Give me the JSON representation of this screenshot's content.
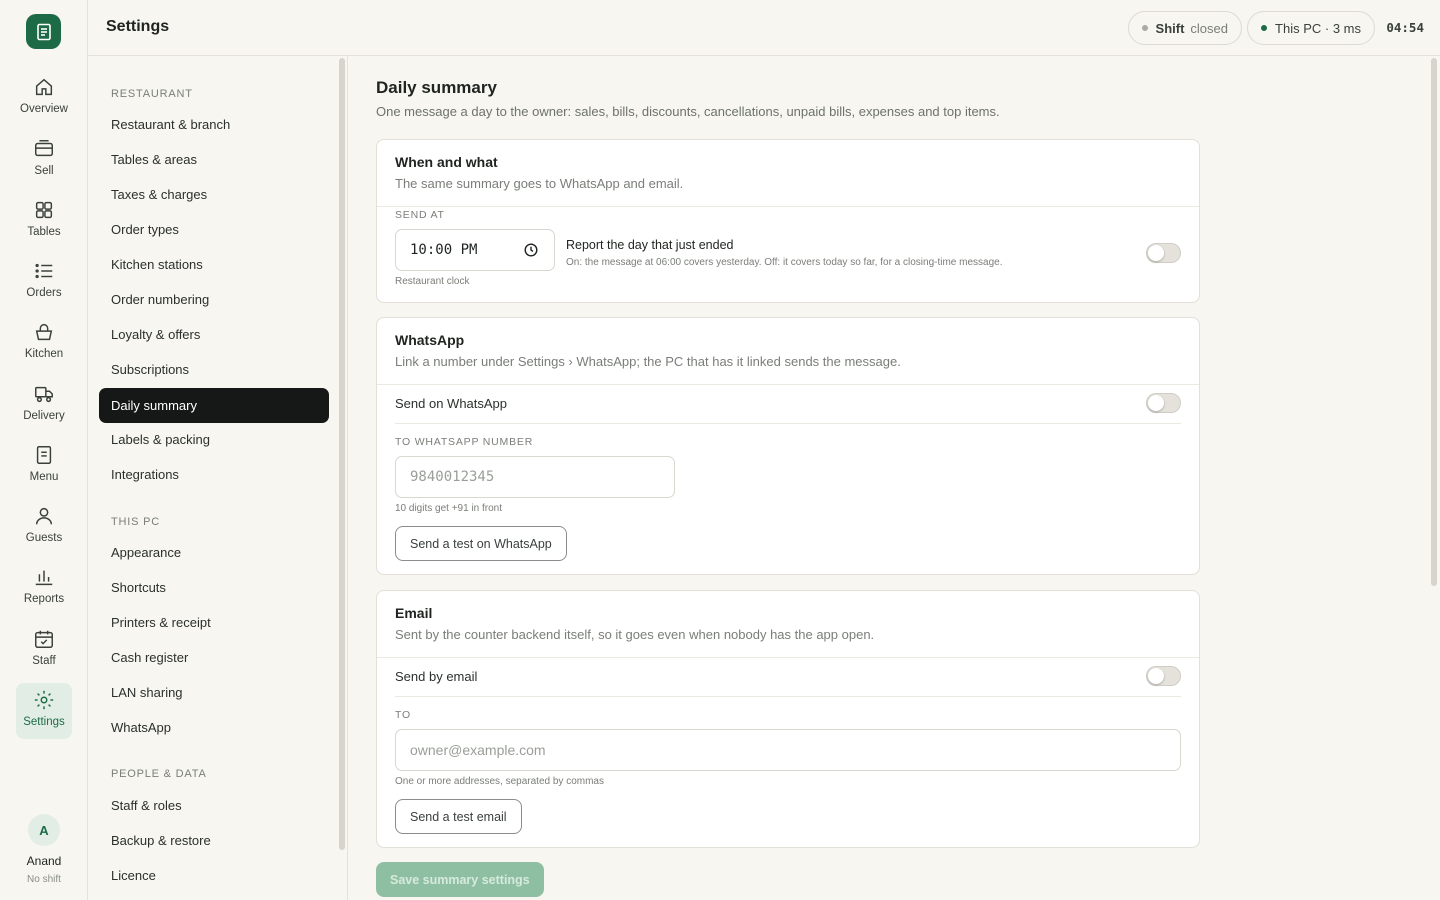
{
  "topbar": {
    "title": "Settings",
    "shift_label": "Shift",
    "shift_status": "closed",
    "pc_status": "This PC · 3 ms",
    "clock": "04:54"
  },
  "rail": {
    "items": [
      {
        "label": "Overview",
        "icon": "home-icon"
      },
      {
        "label": "Sell",
        "icon": "register-icon"
      },
      {
        "label": "Tables",
        "icon": "grid-icon"
      },
      {
        "label": "Orders",
        "icon": "list-icon"
      },
      {
        "label": "Kitchen",
        "icon": "basket-icon"
      },
      {
        "label": "Delivery",
        "icon": "truck-icon"
      },
      {
        "label": "Menu",
        "icon": "menu-doc-icon"
      },
      {
        "label": "Guests",
        "icon": "person-icon"
      },
      {
        "label": "Reports",
        "icon": "bar-chart-icon"
      },
      {
        "label": "Staff",
        "icon": "calendar-icon"
      },
      {
        "label": "Settings",
        "icon": "sun-gear-icon"
      }
    ],
    "user": {
      "initial": "A",
      "name": "Anand",
      "shift": "No shift"
    }
  },
  "settings_nav": {
    "sections": [
      {
        "title": "RESTAURANT",
        "items": [
          "Restaurant & branch",
          "Tables & areas",
          "Taxes & charges",
          "Order types",
          "Kitchen stations",
          "Order numbering",
          "Loyalty & offers",
          "Subscriptions",
          "Daily summary",
          "Labels & packing",
          "Integrations"
        ]
      },
      {
        "title": "THIS PC",
        "items": [
          "Appearance",
          "Shortcuts",
          "Printers & receipt",
          "Cash register",
          "LAN sharing",
          "WhatsApp"
        ]
      },
      {
        "title": "PEOPLE & DATA",
        "items": [
          "Staff & roles",
          "Backup & restore",
          "Licence"
        ]
      }
    ],
    "active": "Daily summary"
  },
  "page": {
    "title": "Daily summary",
    "lead": "One message a day to the owner: sales, bills, discounts, cancellations, unpaid bills, expenses and top items.",
    "when": {
      "title": "When and what",
      "subtitle": "The same summary goes to WhatsApp and email.",
      "send_at_label": "SEND AT",
      "send_at_value": "10:00 PM",
      "clock_hint": "Restaurant clock",
      "report_title": "Report the day that just ended",
      "report_desc": "On: the message at 06:00 covers yesterday. Off: it covers today so far, for a closing-time message."
    },
    "whatsapp": {
      "title": "WhatsApp",
      "subtitle": "Link a number under Settings › WhatsApp; the PC that has it linked sends the message.",
      "toggle_label": "Send on WhatsApp",
      "number_label": "TO WHATSAPP NUMBER",
      "number_placeholder": "9840012345",
      "number_hint": "10 digits get +91 in front",
      "test_button": "Send a test on WhatsApp"
    },
    "email": {
      "title": "Email",
      "subtitle": "Sent by the counter backend itself, so it goes even when nobody has the app open.",
      "toggle_label": "Send by email",
      "to_label": "TO",
      "to_placeholder": "owner@example.com",
      "to_hint": "One or more addresses, separated by commas",
      "test_button": "Send a test email"
    },
    "save_button": "Save summary settings"
  },
  "colors": {
    "accent": "#1d6b46",
    "active_nav": "#151816",
    "save_disabled": "#8fbfa3"
  }
}
